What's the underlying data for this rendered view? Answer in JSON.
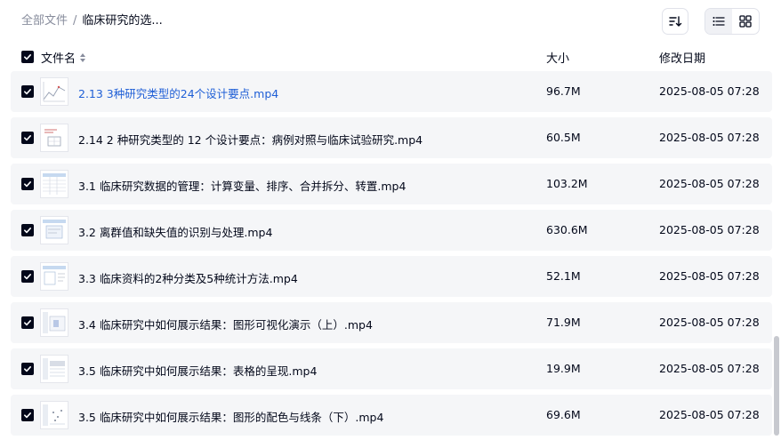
{
  "breadcrumb": {
    "root": "全部文件",
    "separator": "/",
    "current": "临床研究的选..."
  },
  "columns": {
    "name": "文件名",
    "size": "大小",
    "modified": "修改日期"
  },
  "files": [
    {
      "name": "2.13 3种研究类型的24个设计要点.mp4",
      "size": "96.7M",
      "modified": "2025-08-05 07:28",
      "checked": true,
      "highlighted": true
    },
    {
      "name": "2.14 2 种研究类型的 12 个设计要点：病例对照与临床试验研究.mp4",
      "size": "60.5M",
      "modified": "2025-08-05 07:28",
      "checked": true
    },
    {
      "name": "3.1 临床研究数据的管理：计算变量、排序、合并拆分、转置.mp4",
      "size": "103.2M",
      "modified": "2025-08-05 07:28",
      "checked": true
    },
    {
      "name": "3.2 离群值和缺失值的识别与处理.mp4",
      "size": "630.6M",
      "modified": "2025-08-05 07:28",
      "checked": true
    },
    {
      "name": "3.3 临床资料的2种分类及5种统计方法.mp4",
      "size": "52.1M",
      "modified": "2025-08-05 07:28",
      "checked": true
    },
    {
      "name": "3.4 临床研究中如何展示结果：图形可视化演示（上）.mp4",
      "size": "71.9M",
      "modified": "2025-08-05 07:28",
      "checked": true
    },
    {
      "name": "3.5 临床研究中如何展示结果：表格的呈现.mp4",
      "size": "19.9M",
      "modified": "2025-08-05 07:28",
      "checked": true
    },
    {
      "name": "3.5 临床研究中如何展示结果：图形的配色与线条（下）.mp4",
      "size": "69.6M",
      "modified": "2025-08-05 07:28",
      "checked": true
    }
  ],
  "icons": {
    "sort": "sort-icon",
    "list_view": "list-view-icon",
    "grid_view": "grid-view-icon",
    "checkbox": "checkbox-checked-icon",
    "column_sort": "sort-arrows-icon"
  },
  "colors": {
    "checkbox": "#03081a",
    "link": "#1f5fd6",
    "row_bg": "#f5f6f8",
    "muted": "#878c9c"
  },
  "view_mode": "list"
}
